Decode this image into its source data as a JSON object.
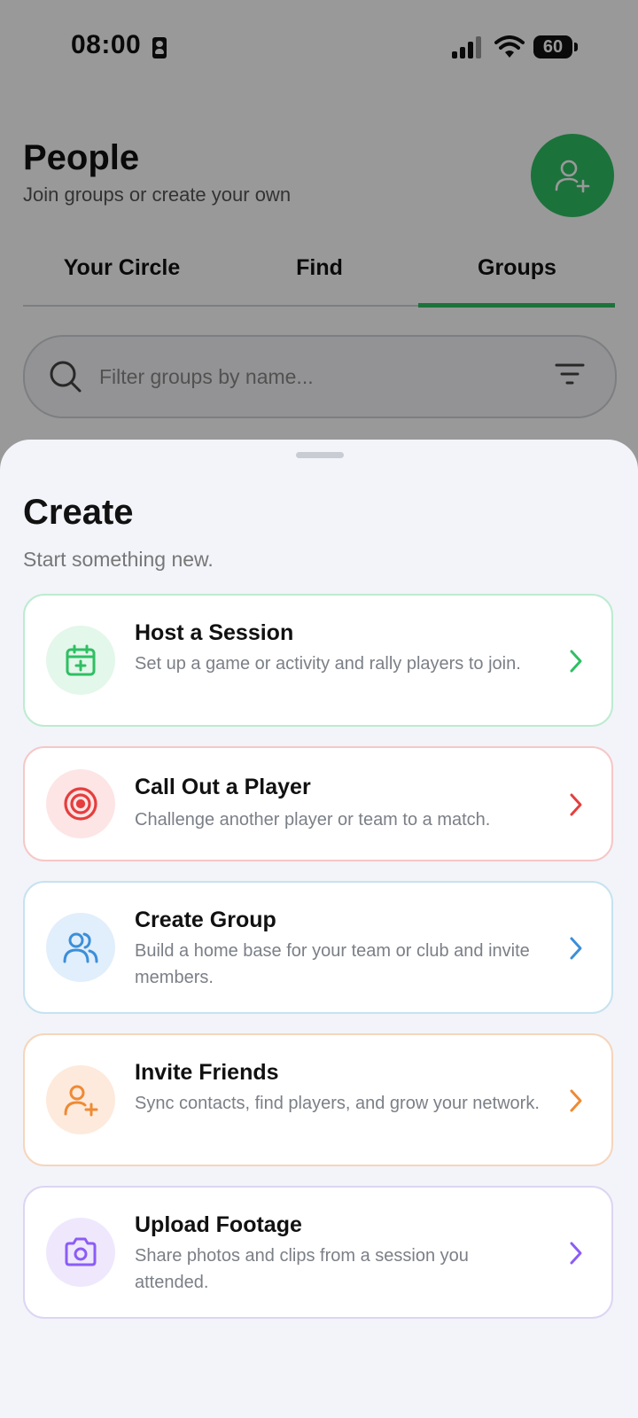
{
  "status_bar": {
    "time": "08:00",
    "battery": "60"
  },
  "header": {
    "title": "People",
    "subtitle": "Join groups or create your own"
  },
  "tabs": [
    {
      "label": "Your Circle"
    },
    {
      "label": "Find"
    },
    {
      "label": "Groups"
    }
  ],
  "active_tab": "Groups",
  "search": {
    "placeholder": "Filter groups by name..."
  },
  "sheet": {
    "title": "Create",
    "subtitle": "Start something new.",
    "items": [
      {
        "title": "Host a Session",
        "description": "Set up a game or activity and rally players to join.",
        "icon": "calendar-plus-icon",
        "color": "#2fbf63",
        "bg": "#e3f7ea",
        "border": "#bdebd0"
      },
      {
        "title": "Call Out a Player",
        "description": "Challenge another player or team to a match.",
        "icon": "target-icon",
        "color": "#e53e3e",
        "bg": "#fde5e5",
        "border": "#f6c7c7"
      },
      {
        "title": "Create Group",
        "description": "Build a home base for your team or club and invite members.",
        "icon": "users-icon",
        "color": "#3b8fd9",
        "bg": "#e1eefb",
        "border": "#c6e2f0"
      },
      {
        "title": "Invite Friends",
        "description": "Sync contacts, find players, and grow your network.",
        "icon": "user-plus-icon",
        "color": "#ef8a34",
        "bg": "#fdeadc",
        "border": "#f6d5bb"
      },
      {
        "title": "Upload Footage",
        "description": "Share photos and clips from a session you attended.",
        "icon": "camera-icon",
        "color": "#8b5cf6",
        "bg": "#efe8fd",
        "border": "#ddd5f3"
      }
    ]
  }
}
